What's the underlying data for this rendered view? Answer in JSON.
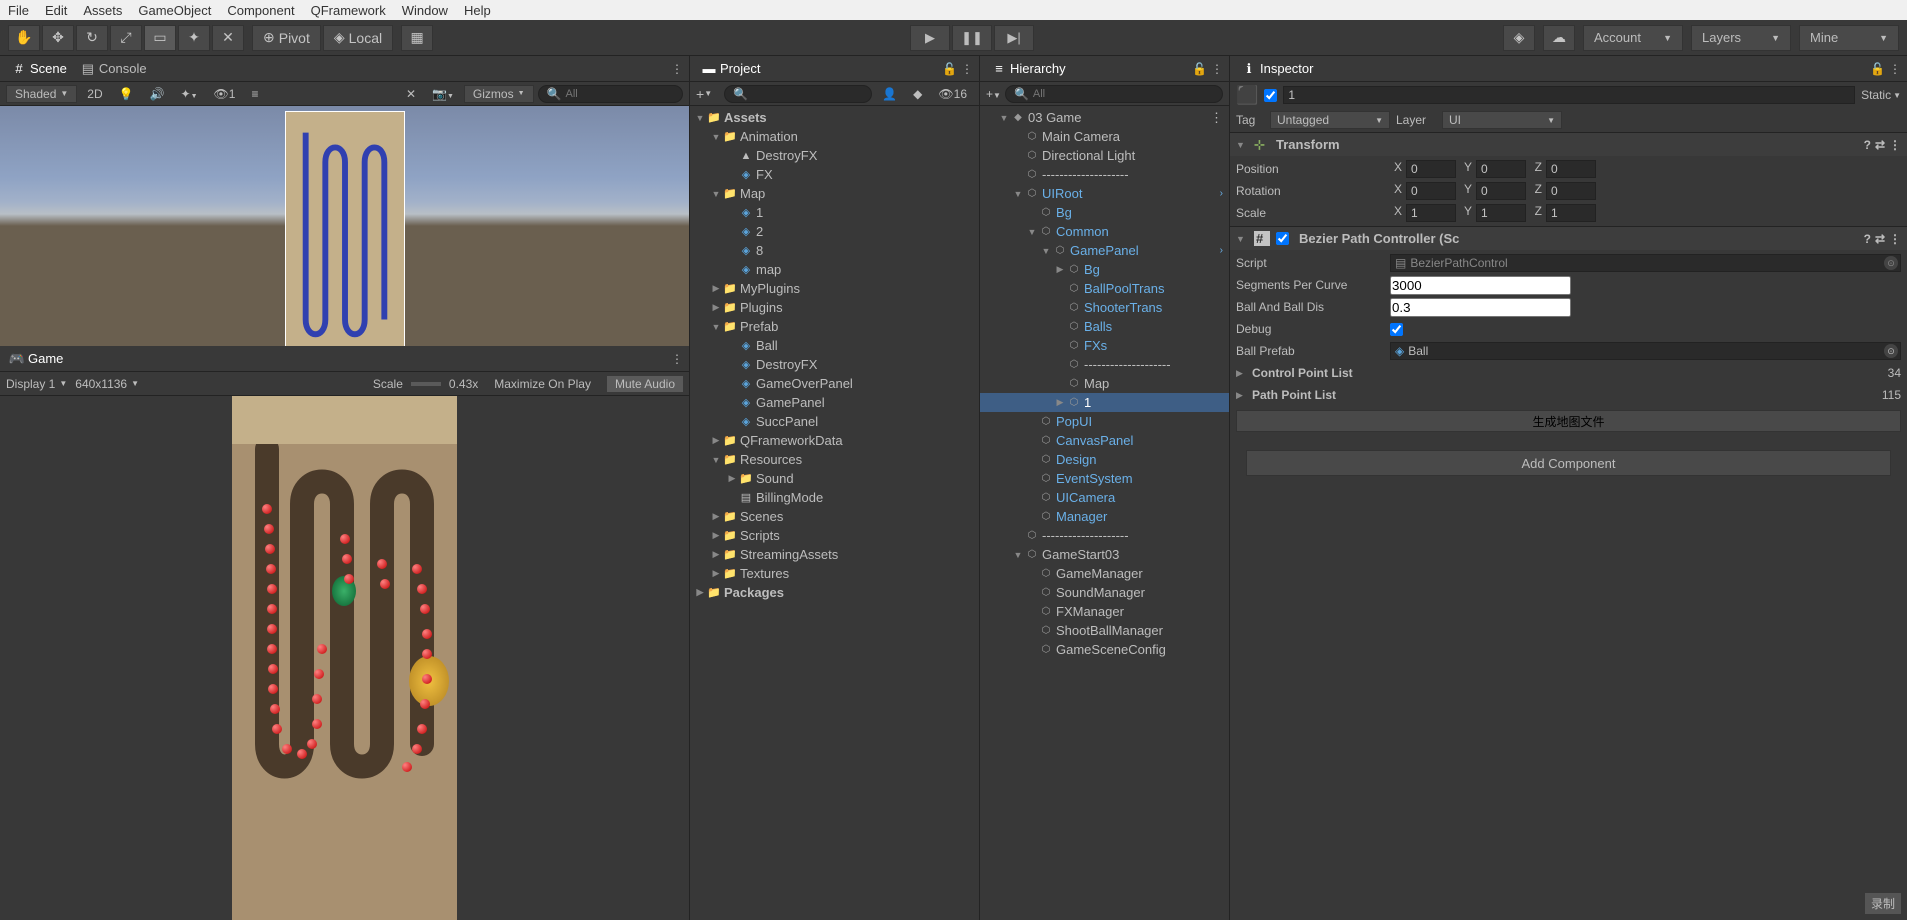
{
  "menubar": [
    "File",
    "Edit",
    "Assets",
    "GameObject",
    "Component",
    "QFramework",
    "Window",
    "Help"
  ],
  "toolbar": {
    "pivot": "Pivot",
    "local": "Local",
    "account": "Account",
    "layers": "Layers",
    "layout": "Mine"
  },
  "scene": {
    "tab_scene": "Scene",
    "tab_console": "Console",
    "shading": "Shaded",
    "mode2d": "2D",
    "overlay1": "1",
    "gizmos": "Gizmos",
    "search_ph": "All"
  },
  "game": {
    "tab": "Game",
    "display": "Display 1",
    "resolution": "640x1136",
    "scale_label": "Scale",
    "scale_val": "0.43x",
    "maximize": "Maximize On Play",
    "mute": "Mute Audio"
  },
  "project": {
    "title": "Project",
    "search_ph": "",
    "hidden_count": "16",
    "tree": [
      {
        "d": 0,
        "t": "Assets",
        "ico": "folder",
        "fold": "down",
        "bold": true
      },
      {
        "d": 1,
        "t": "Animation",
        "ico": "folder",
        "fold": "down"
      },
      {
        "d": 2,
        "t": "DestroyFX",
        "ico": "anim",
        "fold": "none"
      },
      {
        "d": 2,
        "t": "FX",
        "ico": "cube",
        "fold": "none"
      },
      {
        "d": 1,
        "t": "Map",
        "ico": "folder",
        "fold": "down"
      },
      {
        "d": 2,
        "t": "1",
        "ico": "cube",
        "fold": "none"
      },
      {
        "d": 2,
        "t": "2",
        "ico": "cube",
        "fold": "none"
      },
      {
        "d": 2,
        "t": "8",
        "ico": "cube",
        "fold": "none"
      },
      {
        "d": 2,
        "t": "map",
        "ico": "cube",
        "fold": "none"
      },
      {
        "d": 1,
        "t": "MyPlugins",
        "ico": "folder",
        "fold": "right"
      },
      {
        "d": 1,
        "t": "Plugins",
        "ico": "folder",
        "fold": "right"
      },
      {
        "d": 1,
        "t": "Prefab",
        "ico": "folder",
        "fold": "down"
      },
      {
        "d": 2,
        "t": "Ball",
        "ico": "cube",
        "fold": "none"
      },
      {
        "d": 2,
        "t": "DestroyFX",
        "ico": "cube",
        "fold": "none"
      },
      {
        "d": 2,
        "t": "GameOverPanel",
        "ico": "cube",
        "fold": "none"
      },
      {
        "d": 2,
        "t": "GamePanel",
        "ico": "cube",
        "fold": "none"
      },
      {
        "d": 2,
        "t": "SuccPanel",
        "ico": "cube",
        "fold": "none"
      },
      {
        "d": 1,
        "t": "QFrameworkData",
        "ico": "folder",
        "fold": "right"
      },
      {
        "d": 1,
        "t": "Resources",
        "ico": "folder",
        "fold": "down"
      },
      {
        "d": 2,
        "t": "Sound",
        "ico": "folder",
        "fold": "right"
      },
      {
        "d": 2,
        "t": "BillingMode",
        "ico": "file",
        "fold": "none"
      },
      {
        "d": 1,
        "t": "Scenes",
        "ico": "folder",
        "fold": "right"
      },
      {
        "d": 1,
        "t": "Scripts",
        "ico": "folder",
        "fold": "right"
      },
      {
        "d": 1,
        "t": "StreamingAssets",
        "ico": "folder",
        "fold": "right"
      },
      {
        "d": 1,
        "t": "Textures",
        "ico": "folder",
        "fold": "right"
      },
      {
        "d": 0,
        "t": "Packages",
        "ico": "folder",
        "fold": "right",
        "bold": true
      }
    ]
  },
  "hierarchy": {
    "title": "Hierarchy",
    "search_ph": "All",
    "tree": [
      {
        "d": 0,
        "t": "03 Game",
        "ico": "unity",
        "fold": "down",
        "blue": false,
        "menu": true
      },
      {
        "d": 1,
        "t": "Main Camera",
        "ico": "go",
        "fold": "none"
      },
      {
        "d": 1,
        "t": "Directional Light",
        "ico": "go",
        "fold": "none"
      },
      {
        "d": 1,
        "t": "--------------------",
        "ico": "go",
        "fold": "none"
      },
      {
        "d": 1,
        "t": "UIRoot",
        "ico": "go",
        "fold": "down",
        "blue": true,
        "arrow": true
      },
      {
        "d": 2,
        "t": "Bg",
        "ico": "go",
        "fold": "none",
        "blue": true
      },
      {
        "d": 2,
        "t": "Common",
        "ico": "go",
        "fold": "down",
        "blue": true
      },
      {
        "d": 3,
        "t": "GamePanel",
        "ico": "go",
        "fold": "down",
        "blue": true,
        "arrow": true
      },
      {
        "d": 4,
        "t": "Bg",
        "ico": "go",
        "fold": "right",
        "blue": true
      },
      {
        "d": 4,
        "t": "BallPoolTrans",
        "ico": "go",
        "fold": "none",
        "blue": true
      },
      {
        "d": 4,
        "t": "ShooterTrans",
        "ico": "go",
        "fold": "none",
        "blue": true
      },
      {
        "d": 4,
        "t": "Balls",
        "ico": "go",
        "fold": "none",
        "blue": true
      },
      {
        "d": 4,
        "t": "FXs",
        "ico": "go",
        "fold": "none",
        "blue": true
      },
      {
        "d": 4,
        "t": "--------------------",
        "ico": "go",
        "fold": "none"
      },
      {
        "d": 4,
        "t": "Map",
        "ico": "go",
        "fold": "none"
      },
      {
        "d": 4,
        "t": "1",
        "ico": "go",
        "fold": "right",
        "selected": true
      },
      {
        "d": 2,
        "t": "PopUI",
        "ico": "go",
        "fold": "none",
        "blue": true
      },
      {
        "d": 2,
        "t": "CanvasPanel",
        "ico": "go",
        "fold": "none",
        "blue": true
      },
      {
        "d": 2,
        "t": "Design",
        "ico": "go",
        "fold": "none",
        "blue": true
      },
      {
        "d": 2,
        "t": "EventSystem",
        "ico": "go",
        "fold": "none",
        "blue": true
      },
      {
        "d": 2,
        "t": "UICamera",
        "ico": "go",
        "fold": "none",
        "blue": true
      },
      {
        "d": 2,
        "t": "Manager",
        "ico": "go",
        "fold": "none",
        "blue": true
      },
      {
        "d": 1,
        "t": "--------------------",
        "ico": "go",
        "fold": "none"
      },
      {
        "d": 1,
        "t": "GameStart03",
        "ico": "go",
        "fold": "down"
      },
      {
        "d": 2,
        "t": "GameManager",
        "ico": "go",
        "fold": "none"
      },
      {
        "d": 2,
        "t": "SoundManager",
        "ico": "go",
        "fold": "none"
      },
      {
        "d": 2,
        "t": "FXManager",
        "ico": "go",
        "fold": "none"
      },
      {
        "d": 2,
        "t": "ShootBallManager",
        "ico": "go",
        "fold": "none"
      },
      {
        "d": 2,
        "t": "GameSceneConfig",
        "ico": "go",
        "fold": "none"
      }
    ]
  },
  "inspector": {
    "title": "Inspector",
    "obj_name": "1",
    "static_label": "Static",
    "tag_label": "Tag",
    "tag_value": "Untagged",
    "layer_label": "Layer",
    "layer_value": "UI",
    "transform": {
      "title": "Transform",
      "pos": "Position",
      "rot": "Rotation",
      "scl": "Scale",
      "pos_x": "0",
      "pos_y": "0",
      "pos_z": "0",
      "rot_x": "0",
      "rot_y": "0",
      "rot_z": "0",
      "scl_x": "1",
      "scl_y": "1",
      "scl_z": "1"
    },
    "bezier": {
      "title": "Bezier Path Controller (Sc",
      "script_label": "Script",
      "script_val": "BezierPathControl",
      "seg_label": "Segments Per Curve",
      "seg_val": "3000",
      "dis_label": "Ball And Ball Dis",
      "dis_val": "0.3",
      "debug_label": "Debug",
      "debug_val": true,
      "prefab_label": "Ball Prefab",
      "prefab_val": "Ball",
      "cpl_label": "Control Point List",
      "cpl_val": "34",
      "ppl_label": "Path Point List",
      "ppl_val": "115",
      "gen_btn": "生成地图文件"
    },
    "add_comp": "Add Component"
  },
  "footer": {
    "rec": "录制"
  }
}
